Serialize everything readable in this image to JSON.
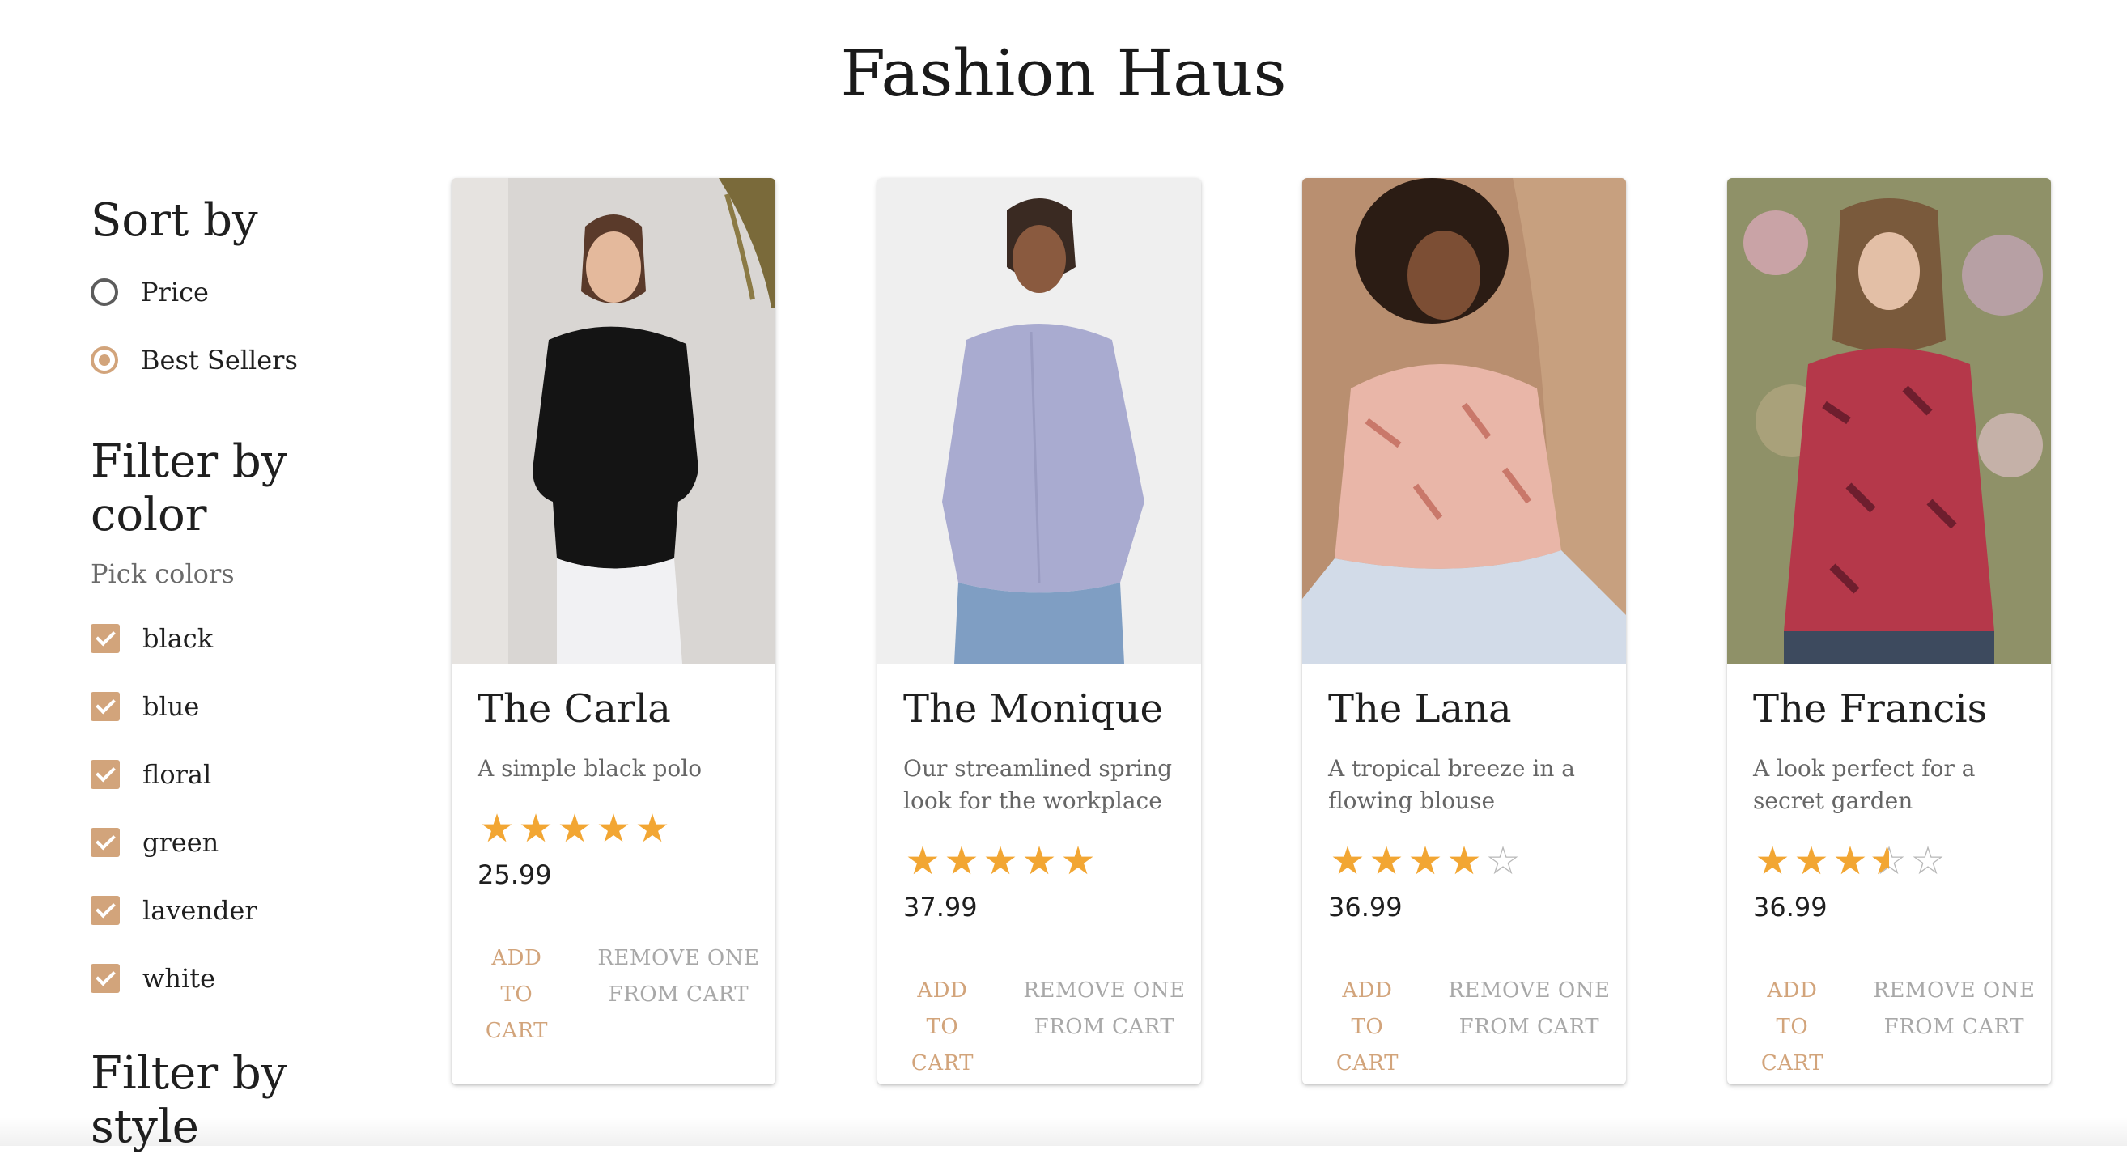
{
  "app": {
    "title": "Fashion Haus"
  },
  "sidebar": {
    "sort": {
      "heading": "Sort by",
      "options": [
        {
          "label": "Price",
          "checked": false
        },
        {
          "label": "Best Sellers",
          "checked": true
        }
      ]
    },
    "color_filter": {
      "heading": "Filter by color",
      "helper": "Pick colors",
      "options": [
        "black",
        "blue",
        "floral",
        "green",
        "lavender",
        "white"
      ]
    },
    "style_filter": {
      "heading": "Filter by style"
    }
  },
  "products": [
    {
      "name": "The Carla",
      "description": "A simple black polo",
      "rating": 5,
      "price": "25.99",
      "add_label": "ADD TO CART",
      "remove_label": "REMOVE ONE FROM CART"
    },
    {
      "name": "The Monique",
      "description": "Our streamlined spring look for the workplace",
      "rating": 5,
      "price": "37.99",
      "add_label": "ADD TO CART",
      "remove_label": "REMOVE ONE FROM CART"
    },
    {
      "name": "The Lana",
      "description": "A tropical breeze in a flowing blouse",
      "rating": 4,
      "price": "36.99",
      "add_label": "ADD TO CART",
      "remove_label": "REMOVE ONE FROM CART"
    },
    {
      "name": "The Francis",
      "description": "A look perfect for a secret garden",
      "rating": 3.5,
      "price": "36.99",
      "add_label": "ADD TO CART",
      "remove_label": "REMOVE ONE FROM CART"
    }
  ],
  "colors": {
    "accent": "#d2a47b",
    "star": "#f2a633",
    "muted": "#a8a8a8"
  }
}
